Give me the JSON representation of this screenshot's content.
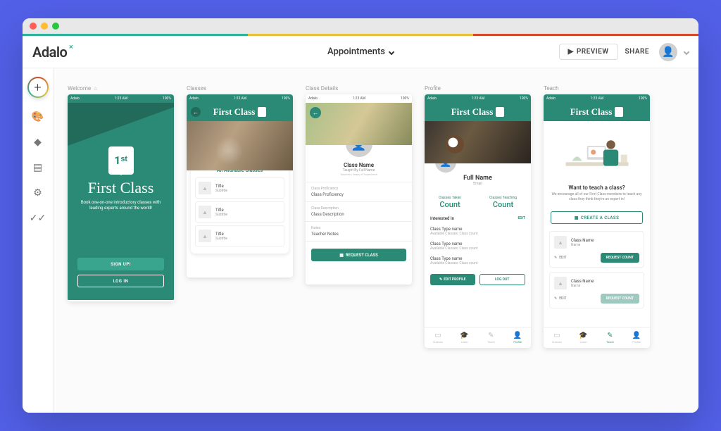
{
  "header": {
    "logo": "Adalo",
    "project_name": "Appointments",
    "preview": "PREVIEW",
    "share": "SHARE"
  },
  "screens": {
    "welcome": {
      "label": "Welcome",
      "brand": "First Class",
      "logo_text": "1ˢᵗ",
      "tag": "Book one-on-one introductory classes with leading experts around the world!",
      "signup": "SIGN UP!",
      "login": "LOG IN"
    },
    "classes": {
      "label": "Classes",
      "brand": "First Class",
      "section": "All Available Classes",
      "items": [
        {
          "title": "Title",
          "subtitle": "Subtitle"
        },
        {
          "title": "Title",
          "subtitle": "Subtitle"
        },
        {
          "title": "Title",
          "subtitle": "Subtitle"
        }
      ]
    },
    "details": {
      "label": "Class Details",
      "name": "Class Name",
      "taught": "Taught By Full Name",
      "exp": "Teacher's Years of Experience",
      "rows": [
        {
          "l": "Class Proficiency",
          "v": "Class Proficiency"
        },
        {
          "l": "Class Description",
          "v": "Class Description"
        },
        {
          "l": "Notes",
          "v": "Teacher Notes"
        }
      ],
      "button": "REQUEST CLASS"
    },
    "profile": {
      "label": "Profile",
      "brand": "First Class",
      "name": "Full Name",
      "email": "Email",
      "stat1_l": "Classes Taken",
      "stat1_v": "Count",
      "stat2_l": "Classes Teaching",
      "stat2_v": "Count",
      "interested": "Interested In",
      "edit": "EDIT",
      "items": [
        {
          "t": "Class Type name",
          "s": "Available Classes: Class count"
        },
        {
          "t": "Class Type name",
          "s": "Available Classes: Class count"
        },
        {
          "t": "Class Type name",
          "s": "Available Classes: Class count"
        }
      ],
      "edit_profile": "EDIT PROFILE",
      "logout": "LOG OUT",
      "tabs": [
        "Classes",
        "Learn",
        "Teach",
        "Profile"
      ]
    },
    "teach": {
      "label": "Teach",
      "brand": "First Class",
      "h": "Want to teach a class?",
      "p": "We encourage all of our First Class members to teach any class they think they're an expert in!",
      "create": "CREATE A CLASS",
      "cards": [
        {
          "title": "Class Name",
          "sub": "Name",
          "req": "REQUEST COUNT"
        },
        {
          "title": "Class Name",
          "sub": "Name",
          "req": "REQUEST COUNT"
        }
      ],
      "edit": "EDIT",
      "tabs": [
        "Classes",
        "Learn",
        "Teach",
        "Profile"
      ]
    }
  },
  "status": {
    "l": "Adalo",
    "c": "1:23 AM",
    "r": "100%"
  }
}
